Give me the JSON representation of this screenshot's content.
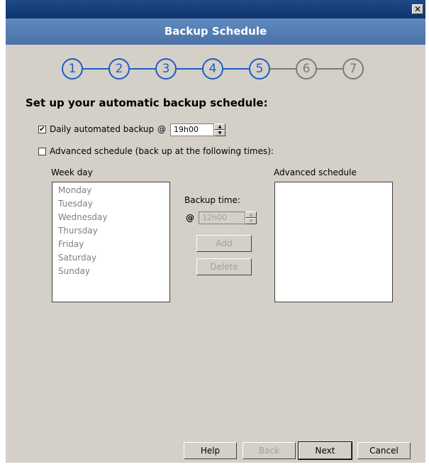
{
  "window": {
    "close_glyph": "✕"
  },
  "header": {
    "title": "Backup Schedule"
  },
  "steps": [
    {
      "number": "1",
      "state": "active"
    },
    {
      "number": "2",
      "state": "active"
    },
    {
      "number": "3",
      "state": "active"
    },
    {
      "number": "4",
      "state": "active"
    },
    {
      "number": "5",
      "state": "active"
    },
    {
      "number": "6",
      "state": "inactive"
    },
    {
      "number": "7",
      "state": "inactive"
    }
  ],
  "main": {
    "heading": "Set up your automatic backup schedule:",
    "daily": {
      "checked": true,
      "label": "Daily automated backup",
      "at": "@",
      "time_value": "19h00"
    },
    "advanced": {
      "checked": false,
      "label": "Advanced schedule (back up at the following times):"
    },
    "weekday": {
      "label": "Week day",
      "items": [
        "Monday",
        "Tuesday",
        "Wednesday",
        "Thursday",
        "Friday",
        "Saturday",
        "Sunday"
      ]
    },
    "backup_time": {
      "label": "Backup time:",
      "at": "@",
      "value": "12h00"
    },
    "add_label": "Add",
    "delete_label": "Delete",
    "advanced_schedule": {
      "label": "Advanced schedule",
      "items": []
    }
  },
  "footer": {
    "help": "Help",
    "back": "Back",
    "next": "Next",
    "cancel": "Cancel"
  },
  "colors": {
    "accent": "#1f5cc4",
    "inactive": "#7a7a7a",
    "header": "#4a72a7",
    "titlebar": "#0e3470",
    "dialog_bg": "#d4d0c8"
  }
}
